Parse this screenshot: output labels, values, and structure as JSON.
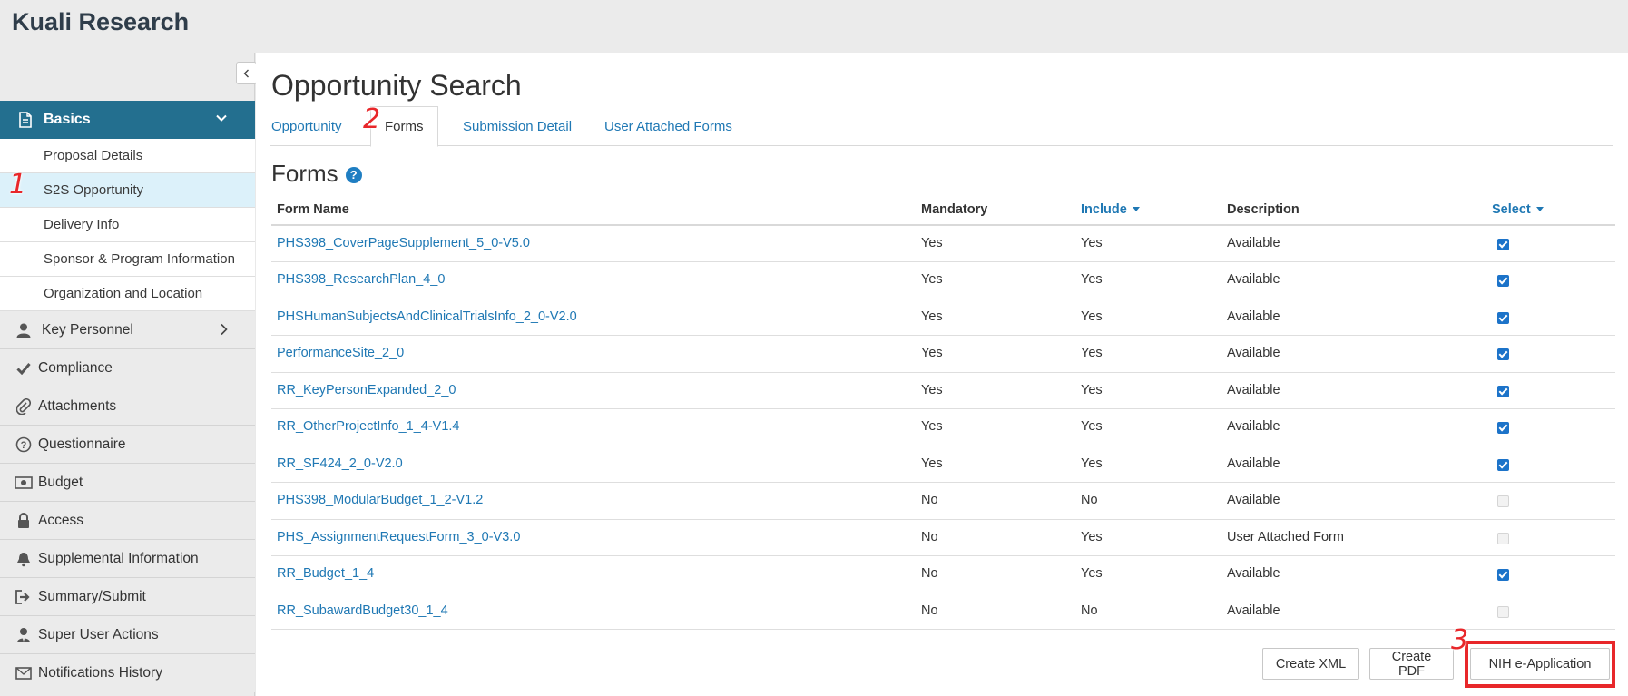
{
  "app": {
    "title": "Kuali Research"
  },
  "sidebar": {
    "section": {
      "label": "Basics",
      "icon": "document-icon"
    },
    "subitems": [
      {
        "label": "Proposal Details"
      },
      {
        "label": "S2S Opportunity"
      },
      {
        "label": "Delivery Info"
      },
      {
        "label": "Sponsor & Program Information"
      },
      {
        "label": "Organization and Location"
      }
    ],
    "items": [
      {
        "label": "Key Personnel",
        "icon": "person-icon"
      },
      {
        "label": "Compliance",
        "icon": "check-icon"
      },
      {
        "label": "Attachments",
        "icon": "paperclip-icon"
      },
      {
        "label": "Questionnaire",
        "icon": "question-icon"
      },
      {
        "label": "Budget",
        "icon": "money-icon"
      },
      {
        "label": "Access",
        "icon": "lock-icon"
      },
      {
        "label": "Supplemental Information",
        "icon": "bell-icon"
      },
      {
        "label": "Summary/Submit",
        "icon": "sign-out-icon"
      },
      {
        "label": "Super User Actions",
        "icon": "user-tie-icon"
      },
      {
        "label": "Notifications History",
        "icon": "envelope-icon"
      }
    ]
  },
  "main": {
    "title": "Opportunity Search",
    "tabs": [
      {
        "label": "Opportunity"
      },
      {
        "label": "Forms"
      },
      {
        "label": "Submission Detail"
      },
      {
        "label": "User Attached Forms"
      }
    ],
    "section_title": "Forms",
    "table": {
      "headers": [
        "Form Name",
        "Mandatory",
        "Include",
        "Description",
        "Select"
      ],
      "rows": [
        {
          "name": "PHS398_CoverPageSupplement_5_0-V5.0",
          "mandatory": "Yes",
          "include": "Yes",
          "description": "Available",
          "selected": true
        },
        {
          "name": "PHS398_ResearchPlan_4_0",
          "mandatory": "Yes",
          "include": "Yes",
          "description": "Available",
          "selected": true
        },
        {
          "name": "PHSHumanSubjectsAndClinicalTrialsInfo_2_0-V2.0",
          "mandatory": "Yes",
          "include": "Yes",
          "description": "Available",
          "selected": true
        },
        {
          "name": "PerformanceSite_2_0",
          "mandatory": "Yes",
          "include": "Yes",
          "description": "Available",
          "selected": true
        },
        {
          "name": "RR_KeyPersonExpanded_2_0",
          "mandatory": "Yes",
          "include": "Yes",
          "description": "Available",
          "selected": true
        },
        {
          "name": "RR_OtherProjectInfo_1_4-V1.4",
          "mandatory": "Yes",
          "include": "Yes",
          "description": "Available",
          "selected": true
        },
        {
          "name": "RR_SF424_2_0-V2.0",
          "mandatory": "Yes",
          "include": "Yes",
          "description": "Available",
          "selected": true
        },
        {
          "name": "PHS398_ModularBudget_1_2-V1.2",
          "mandatory": "No",
          "include": "No",
          "description": "Available",
          "selected": false
        },
        {
          "name": "PHS_AssignmentRequestForm_3_0-V3.0",
          "mandatory": "No",
          "include": "Yes",
          "description": "User Attached Form",
          "selected": false
        },
        {
          "name": "RR_Budget_1_4",
          "mandatory": "No",
          "include": "Yes",
          "description": "Available",
          "selected": true
        },
        {
          "name": "RR_SubawardBudget30_1_4",
          "mandatory": "No",
          "include": "No",
          "description": "Available",
          "selected": false
        }
      ]
    },
    "buttons": {
      "create_xml": "Create XML",
      "create_pdf": "Create PDF",
      "nih": "NIH e-Application"
    }
  },
  "annotations": [
    "1",
    "2",
    "3"
  ],
  "colors": {
    "accent": "#236f8f",
    "link": "#1f78b4",
    "highlight": "#e8272a"
  }
}
